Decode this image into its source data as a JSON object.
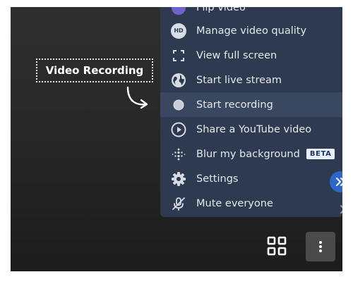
{
  "callout": {
    "label": "Video Recording"
  },
  "menu": {
    "items": [
      {
        "label": "Flip video",
        "icon": "flip-icon"
      },
      {
        "label": "Manage video quality",
        "icon": "hd-icon",
        "icon_text": "HD"
      },
      {
        "label": "View full screen",
        "icon": "fullscreen-icon"
      },
      {
        "label": "Start live stream",
        "icon": "globe-icon"
      },
      {
        "label": "Start recording",
        "icon": "record-icon",
        "highlighted": true
      },
      {
        "label": "Share a YouTube video",
        "icon": "play-circle-icon"
      },
      {
        "label": "Blur my background",
        "icon": "blur-icon",
        "badge": "BETA"
      },
      {
        "label": "Settings",
        "icon": "gear-icon"
      },
      {
        "label": "Mute everyone",
        "icon": "mic-off-icon"
      }
    ]
  },
  "colors": {
    "menu_bg": "#2e3a4f",
    "highlight_bg": "#3a4760",
    "accent_blue": "#2f67c8",
    "beta_bg": "#e8eefc"
  }
}
